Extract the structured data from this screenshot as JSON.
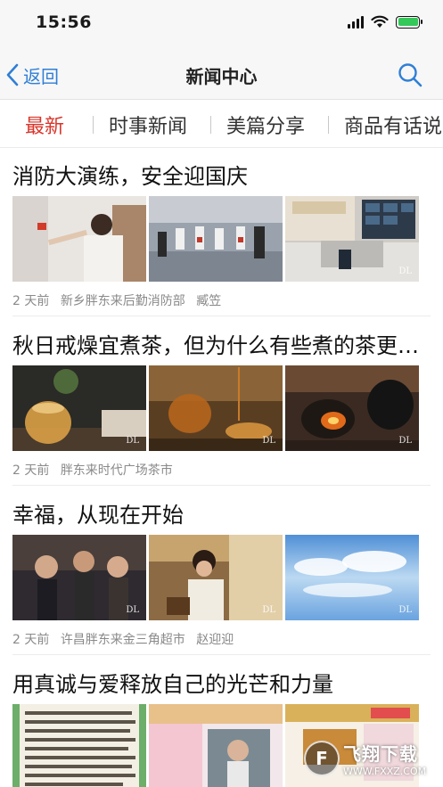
{
  "status": {
    "time": "15:56"
  },
  "nav": {
    "back_label": "返回",
    "title": "新闻中心"
  },
  "tabs": [
    {
      "label": "最新",
      "active": true
    },
    {
      "label": "时事新闻",
      "active": false
    },
    {
      "label": "美篇分享",
      "active": false
    },
    {
      "label": "商品有话说",
      "active": false
    }
  ],
  "articles": [
    {
      "title": "消防大演练，安全迎国庆",
      "time": "2 天前",
      "source": "新乡胖东来后勤消防部",
      "author": "臧笠"
    },
    {
      "title": "秋日戒燥宜煮茶，但为什么有些煮的茶更好喝？",
      "time": "2 天前",
      "source": "胖东来时代广场茶市",
      "author": ""
    },
    {
      "title": "幸福，从现在开始",
      "time": "2 天前",
      "source": "许昌胖东来金三角超市",
      "author": "赵迎迎"
    },
    {
      "title": "用真诚与爱释放自己的光芒和力量",
      "time": "",
      "source": "",
      "author": ""
    }
  ],
  "thumb_watermark": "DL",
  "site_watermark": {
    "name": "飞翔下载",
    "url": "WWW.FXXZ.COM"
  },
  "colors": {
    "accent_red": "#d9362b",
    "link_blue": "#2f7fd6"
  }
}
